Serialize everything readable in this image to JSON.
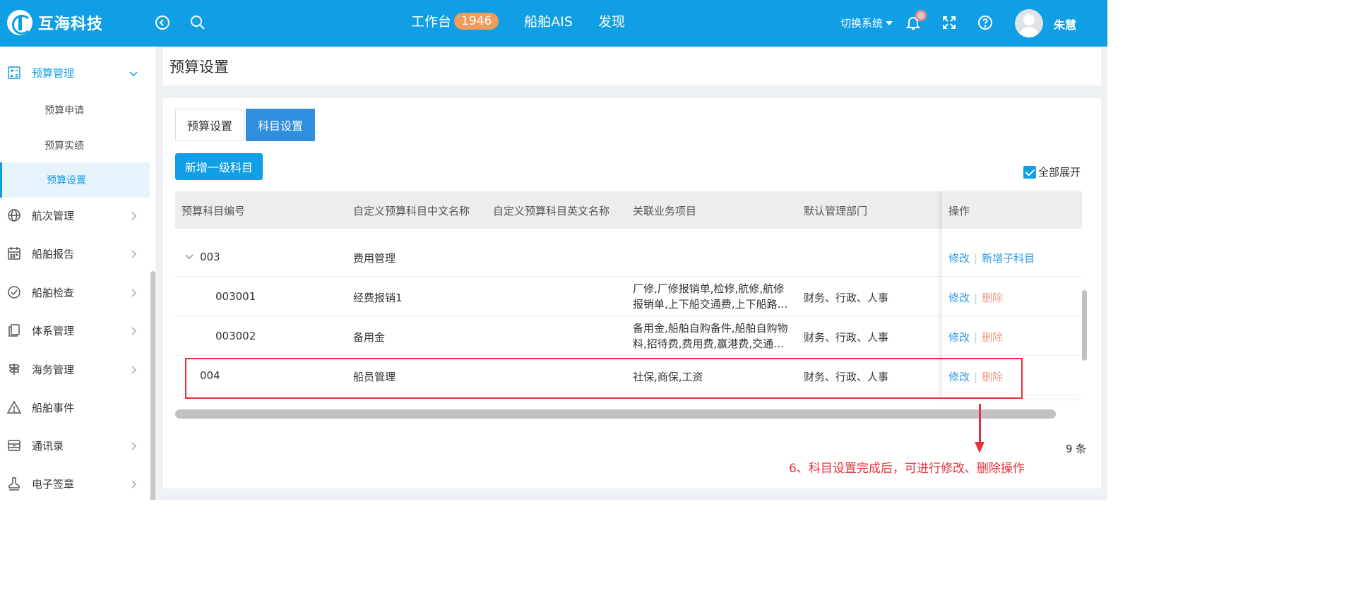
{
  "header": {
    "logo_text": "互海科技",
    "nav": [
      {
        "label": "工作台",
        "badge": "1946"
      },
      {
        "label": "船舶AIS"
      },
      {
        "label": "发现"
      }
    ],
    "switch_label": "切换系统",
    "username": "朱慧"
  },
  "sidebar": {
    "groups": [
      {
        "label": "预算管理",
        "icon": "calculator-icon",
        "expanded": true
      },
      {
        "label": "航次管理",
        "icon": "globe-icon"
      },
      {
        "label": "船舶报告",
        "icon": "calendar-icon"
      },
      {
        "label": "船舶检查",
        "icon": "check-circle-icon"
      },
      {
        "label": "体系管理",
        "icon": "documents-icon"
      },
      {
        "label": "海务管理",
        "icon": "signpost-icon"
      },
      {
        "label": "船舶事件",
        "icon": "warning-icon"
      },
      {
        "label": "通讯录",
        "icon": "drawer-icon"
      },
      {
        "label": "电子签章",
        "icon": "stamp-icon"
      }
    ],
    "sub_items": [
      "预算申请",
      "预算实绩",
      "预算设置"
    ],
    "current_sub": "预算设置"
  },
  "page": {
    "title": "预算设置",
    "tabs": [
      "预算设置",
      "科目设置"
    ],
    "active_tab": "科目设置",
    "add_button": "新增一级科目",
    "expand_all_label": "全部展开",
    "expand_all_checked": true
  },
  "table": {
    "columns": [
      "预算科目编号",
      "自定义预算科目中文名称",
      "自定义预算科目英文名称",
      "关联业务项目",
      "默认管理部门",
      "操作"
    ],
    "rows": [
      {
        "code": "003",
        "cn_name": "费用管理",
        "en_name": "",
        "business_1": "",
        "business_2": "",
        "dept": "",
        "actions": [
          "修改",
          "新增子科目"
        ]
      },
      {
        "code": "003001",
        "cn_name": "经费报销1",
        "en_name": "",
        "business_1": "厂修,厂修报销单,检修,航修,航修",
        "business_2": "报销单,上下船交通费,上下船路…",
        "dept": "财务、行政、人事",
        "actions": [
          "修改",
          "删除"
        ]
      },
      {
        "code": "003002",
        "cn_name": "备用金",
        "en_name": "",
        "business_1": "备用金,船舶自购备件,船舶自购物",
        "business_2": "料,招待费,费用费,赢港费,交通…",
        "dept": "财务、行政、人事",
        "actions": [
          "修改",
          "删除"
        ]
      },
      {
        "code": "004",
        "cn_name": "船员管理",
        "en_name": "",
        "business_1": "社保,商保,工资",
        "business_2": "",
        "dept": "财务、行政、人事",
        "actions": [
          "修改",
          "删除"
        ]
      }
    ],
    "total": "9 条"
  },
  "annotation": {
    "note": "6、科目设置完成后，可进行修改、删除操作",
    "color": "#e7313a"
  },
  "colors": {
    "brand": "#109ee4",
    "link": "#2e9ae0",
    "delete": "#f29b85"
  }
}
